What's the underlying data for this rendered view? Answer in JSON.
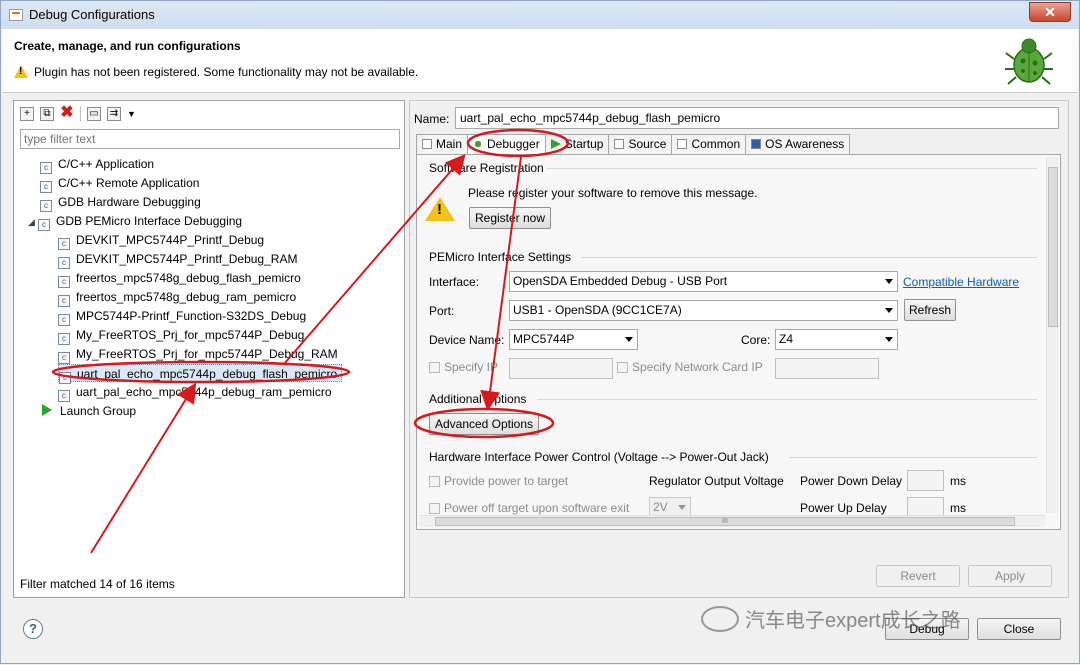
{
  "window": {
    "title": "Debug Configurations",
    "close_label": "✕"
  },
  "banner": {
    "title": "Create, manage, and run configurations",
    "warning": "Plugin has not been registered. Some functionality may not be available."
  },
  "left": {
    "filter_placeholder": "type filter text",
    "tree": [
      {
        "label": "C/C++ Application"
      },
      {
        "label": "C/C++ Remote Application"
      },
      {
        "label": "GDB Hardware Debugging"
      },
      {
        "label": "GDB PEMicro Interface Debugging"
      },
      {
        "label": "DEVKIT_MPC5744P_Printf_Debug"
      },
      {
        "label": "DEVKIT_MPC5744P_Printf_Debug_RAM"
      },
      {
        "label": "freertos_mpc5748g_debug_flash_pemicro"
      },
      {
        "label": "freertos_mpc5748g_debug_ram_pemicro"
      },
      {
        "label": "MPC5744P-Printf_Function-S32DS_Debug"
      },
      {
        "label": "My_FreeRTOS_Prj_for_mpc5744P_Debug"
      },
      {
        "label": "My_FreeRTOS_Prj_for_mpc5744P_Debug_RAM"
      },
      {
        "label": "uart_pal_echo_mpc5744p_debug_flash_pemicro"
      },
      {
        "label": "uart_pal_echo_mpc5744p_debug_ram_pemicro"
      },
      {
        "label": "Launch Group"
      }
    ],
    "status": "Filter matched 14 of 16 items"
  },
  "right": {
    "name_label": "Name:",
    "name_value": "uart_pal_echo_mpc5744p_debug_flash_pemicro",
    "tabs": [
      "Main",
      "Debugger",
      "Startup",
      "Source",
      "Common",
      "OS Awareness"
    ],
    "sw_reg": {
      "title": "Software Registration",
      "message": "Please register your software to remove this message.",
      "button": "Register now"
    },
    "pemicro": {
      "title": "PEMicro Interface Settings",
      "interface_label": "Interface:",
      "interface_value": "OpenSDA Embedded Debug - USB Port",
      "compat_link": "Compatible Hardware",
      "port_label": "Port:",
      "port_value": "USB1 - OpenSDA (9CC1CE7A)",
      "refresh": "Refresh",
      "device_label": "Device Name:",
      "device_value": "MPC5744P",
      "core_label": "Core:",
      "core_value": "Z4",
      "specify_ip": "Specify IP",
      "specify_nic": "Specify Network Card IP"
    },
    "additional": {
      "title": "Additional Options",
      "button": "Advanced Options"
    },
    "power": {
      "title": "Hardware Interface Power Control (Voltage --> Power-Out Jack)",
      "provide_power": "Provide power to target",
      "reg_voltage": "Regulator Output Voltage",
      "power_down": "Power Down Delay",
      "ms1": "ms",
      "power_off": "Power off target upon software exit",
      "voltage_value": "2V",
      "power_up": "Power Up Delay",
      "ms2": "ms"
    },
    "scroll_grip": "III",
    "revert": "Revert",
    "apply": "Apply"
  },
  "footer": {
    "help": "?",
    "debug": "Debug",
    "close": "Close"
  },
  "watermark": "汽车电子expert成长之路",
  "colors": {
    "annotation": "#d7191c",
    "link": "#0b5cc5",
    "warning": "#f3c21a"
  }
}
